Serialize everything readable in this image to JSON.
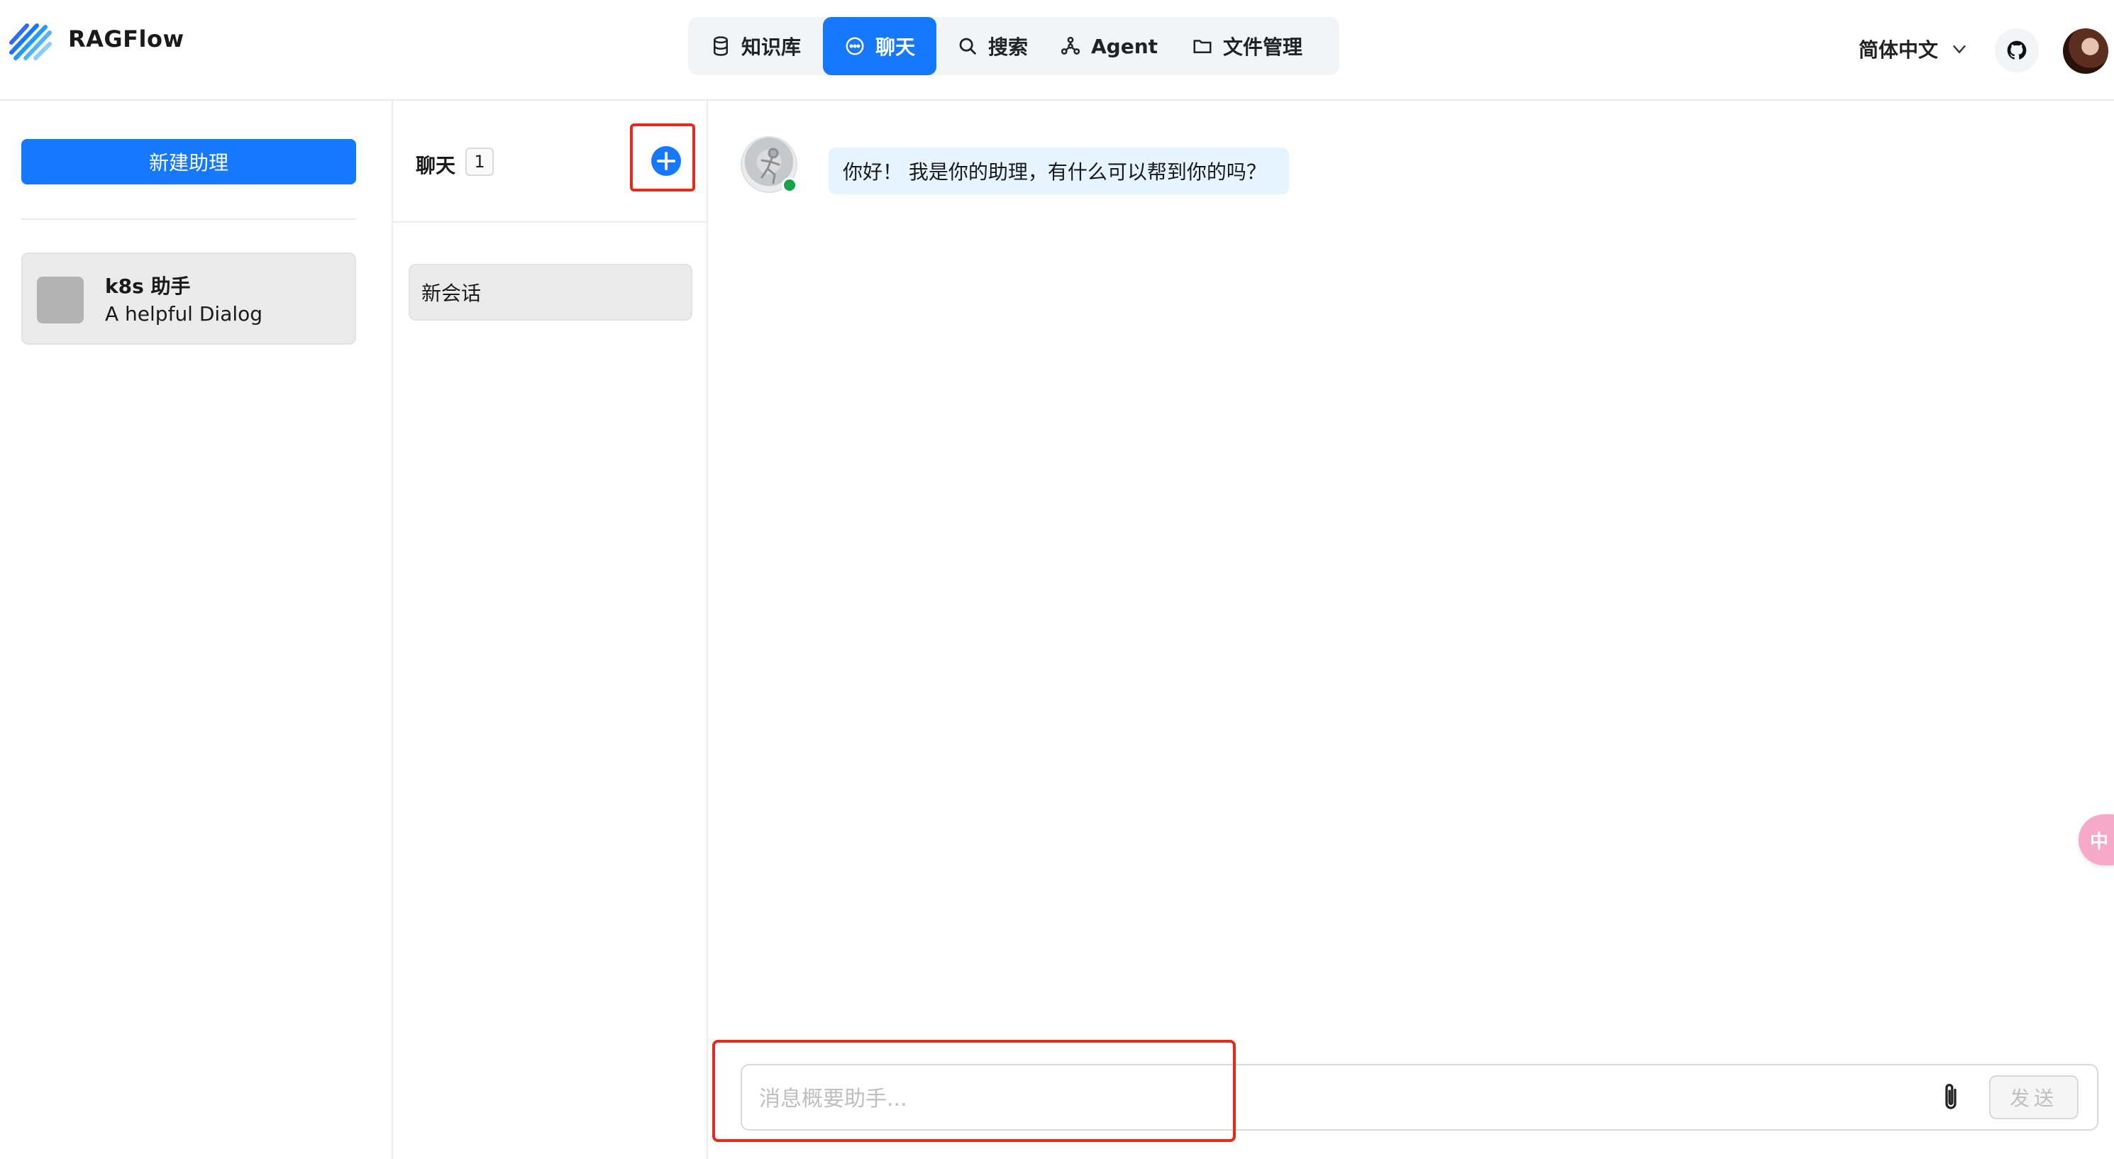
{
  "app": {
    "brand": "RAGFlow",
    "accent_color": "#1677ff",
    "highlight_color": "#e8281b"
  },
  "nav": {
    "items": [
      {
        "label": "知识库",
        "icon": "database-icon",
        "active": false
      },
      {
        "label": "聊天",
        "icon": "chat-bubble-icon",
        "active": true
      },
      {
        "label": "搜索",
        "icon": "search-icon",
        "active": false
      },
      {
        "label": "Agent",
        "icon": "agent-graph-icon",
        "active": false
      },
      {
        "label": "文件管理",
        "icon": "folder-icon",
        "active": false
      }
    ]
  },
  "header_right": {
    "language": "简体中文",
    "github_icon": "github-icon",
    "avatar": "user-avatar"
  },
  "assistants": {
    "new_button_label": "新建助理",
    "items": [
      {
        "name": "k8s 助手",
        "description": "A helpful Dialog"
      }
    ]
  },
  "conversations": {
    "title": "聊天",
    "count": "1",
    "add_icon": "plus-circle-icon",
    "items": [
      {
        "name": "新会话"
      }
    ]
  },
  "chat": {
    "messages": [
      {
        "role": "assistant",
        "text": "你好！ 我是你的助理，有什么可以帮到你的吗？"
      }
    ],
    "input": {
      "placeholder": "消息概要助手...",
      "value": ""
    },
    "send_label": "发送",
    "attach_icon": "paperclip-icon"
  },
  "floating_tab": {
    "label": "中"
  }
}
